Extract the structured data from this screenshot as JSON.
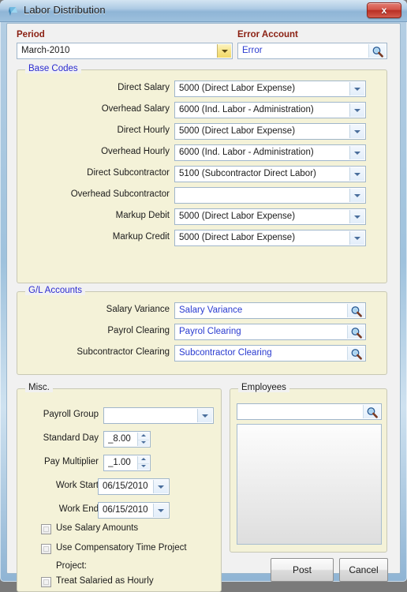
{
  "window": {
    "title": "Labor Distribution",
    "icon": "app-icon",
    "close_label": "x"
  },
  "top": {
    "period_label": "Period",
    "period_value": "March-2010",
    "error_account_label": "Error Account",
    "error_account_value": "Error",
    "error_account_lookup_icon": "magnifier-icon"
  },
  "base_codes": {
    "title": "Base Codes",
    "rows": [
      {
        "label": "Direct Salary",
        "value": "5000 (Direct Labor Expense)"
      },
      {
        "label": "Overhead Salary",
        "value": "6000 (Ind. Labor - Administration)"
      },
      {
        "label": "Direct Hourly",
        "value": "5000 (Direct Labor Expense)"
      },
      {
        "label": "Overhead Hourly",
        "value": "6000 (Ind. Labor - Administration)"
      },
      {
        "label": "Direct Subcontractor",
        "value": "5100 (Subcontractor Direct Labor)"
      },
      {
        "label": "Overhead Subcontractor",
        "value": ""
      },
      {
        "label": "Markup Debit",
        "value": "5000 (Direct Labor Expense)"
      },
      {
        "label": "Markup Credit",
        "value": "5000 (Direct Labor Expense)"
      }
    ]
  },
  "gl_accounts": {
    "title": "G/L Accounts",
    "rows": [
      {
        "label": "Salary Variance",
        "value": "Salary Variance"
      },
      {
        "label": "Payrol Clearing",
        "value": "Payrol Clearing"
      },
      {
        "label": "Subcontractor Clearing",
        "value": "Subcontractor Clearing"
      }
    ]
  },
  "misc": {
    "title": "Misc.",
    "payroll_group_label": "Payroll Group",
    "payroll_group_value": "",
    "standard_day_label": "Standard Day",
    "standard_day_value": "_8.00",
    "pay_multiplier_label": "Pay Multiplier",
    "pay_multiplier_value": "_1.00",
    "work_start_label": "Work Start",
    "work_start_value": "06/15/2010",
    "work_end_label": "Work End",
    "work_end_value": "06/15/2010",
    "checkboxes": [
      {
        "label": "Use Salary Amounts",
        "checked": false
      },
      {
        "label": "Use Compensatory Time Project",
        "checked": false
      },
      {
        "label": "Treat Salaried as Hourly",
        "checked": false
      }
    ],
    "project_label": "Project:"
  },
  "employees": {
    "title": "Employees",
    "search_value": "",
    "search_icon": "magnifier-icon",
    "items": []
  },
  "actions": {
    "post_label": "Post",
    "cancel_label": "Cancel"
  },
  "colors": {
    "group_bg": "#f4f2d8",
    "label_red": "#8a1f11",
    "group_title_blue": "#2b2bd0",
    "value_blue": "#2a3bd0",
    "close_red": "#b82f24"
  }
}
